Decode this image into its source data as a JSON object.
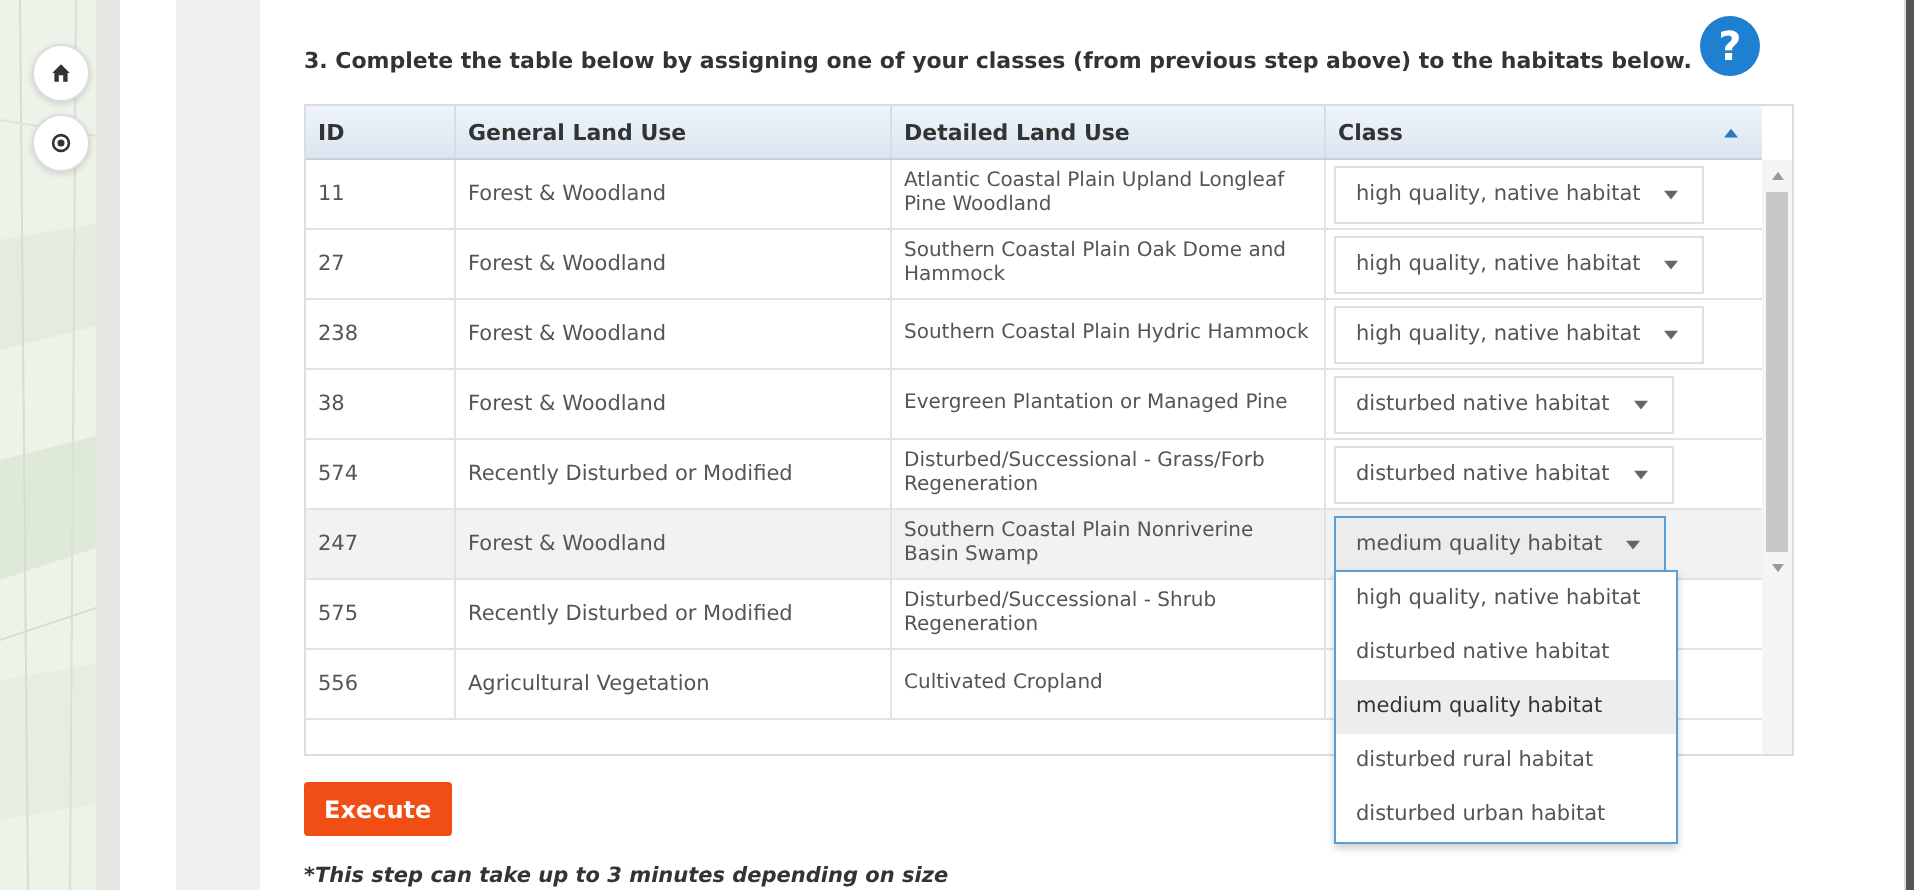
{
  "instruction": "3. Complete the table below by assigning one of your classes (from previous step above) to the habitats below.",
  "help": "?",
  "table": {
    "columns": [
      "ID",
      "General Land Use",
      "Detailed Land Use",
      "Class"
    ],
    "rows": [
      {
        "id": "11",
        "general": "Forest & Woodland",
        "detailed": "Atlantic Coastal Plain Upland Longleaf Pine Woodland",
        "class": "high quality, native habitat",
        "selected": false,
        "open": false
      },
      {
        "id": "27",
        "general": "Forest & Woodland",
        "detailed": "Southern Coastal Plain Oak Dome and Hammock",
        "class": "high quality, native habitat",
        "selected": false,
        "open": false
      },
      {
        "id": "238",
        "general": "Forest & Woodland",
        "detailed": "Southern Coastal Plain Hydric Hammock",
        "class": "high quality, native habitat",
        "selected": false,
        "open": false
      },
      {
        "id": "38",
        "general": "Forest & Woodland",
        "detailed": "Evergreen Plantation or Managed Pine",
        "class": "disturbed native habitat",
        "selected": false,
        "open": false
      },
      {
        "id": "574",
        "general": "Recently Disturbed or Modified",
        "detailed": "Disturbed/Successional - Grass/Forb Regeneration",
        "class": "disturbed native habitat",
        "selected": false,
        "open": false
      },
      {
        "id": "247",
        "general": "Forest & Woodland",
        "detailed": "Southern Coastal Plain Nonriverine Basin Swamp",
        "class": "medium quality habitat",
        "selected": true,
        "open": true
      },
      {
        "id": "575",
        "general": "Recently Disturbed or Modified",
        "detailed": "Disturbed/Successional - Shrub Regeneration"
      },
      {
        "id": "556",
        "general": "Agricultural Vegetation",
        "detailed": "Cultivated Cropland"
      }
    ]
  },
  "dropdown": {
    "options": [
      {
        "label": "high quality, native habitat",
        "selected": false
      },
      {
        "label": "disturbed native habitat",
        "selected": false
      },
      {
        "label": "medium quality habitat",
        "selected": true
      },
      {
        "label": "disturbed rural habitat",
        "selected": false
      },
      {
        "label": "disturbed urban habitat",
        "selected": false
      }
    ]
  },
  "execute_button": "Execute",
  "note": "*This step can take up to 3 minutes depending on size"
}
